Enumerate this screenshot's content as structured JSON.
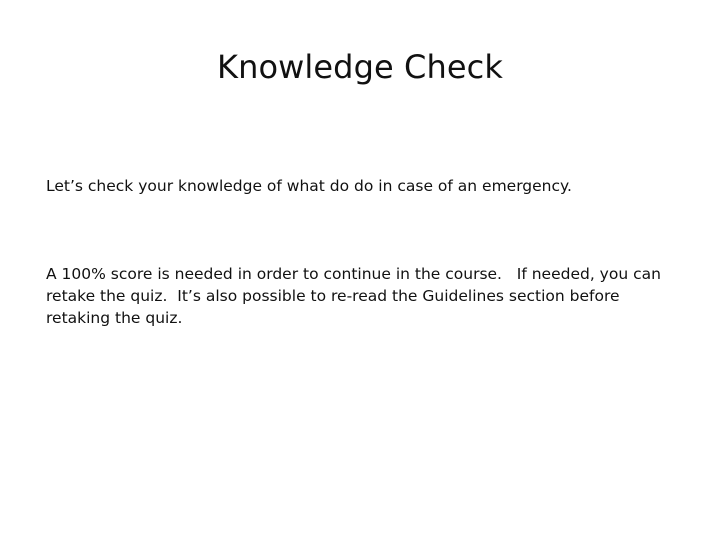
{
  "slide": {
    "title": "Knowledge Check",
    "paragraphs": [
      "Let’s check your knowledge of what do do in case of an emergency.",
      "A 100% score is needed in order to continue in the course.   If needed, you can retake the quiz.  It’s also possible to re-read the Guidelines section before retaking the quiz."
    ]
  }
}
